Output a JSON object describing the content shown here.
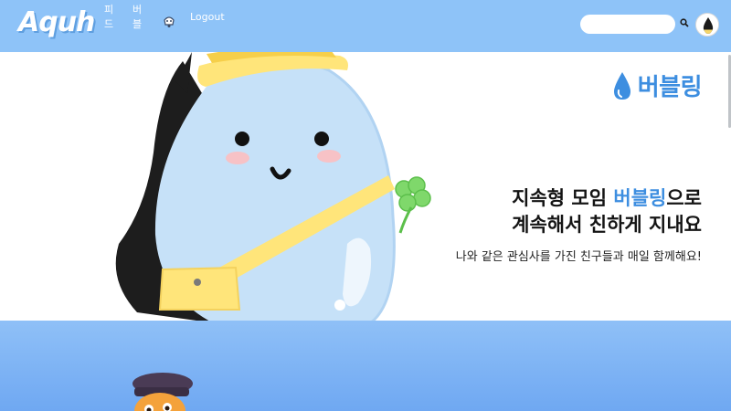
{
  "header": {
    "logo": "Aquh",
    "nav": {
      "feed": "피드",
      "bubble": "버블",
      "logout": "Logout"
    },
    "search": {
      "placeholder": ""
    }
  },
  "hero": {
    "brand": "버블링",
    "headline_part1": "지속형 모임 ",
    "headline_accent": "버블링",
    "headline_part2": "으로",
    "headline_line2": "계속해서 친하게 지내요",
    "subtitle": "나와 같은 관심사를 가진 친구들과 매일 함께해요!"
  },
  "colors": {
    "header_bg": "#8ec3f8",
    "accent": "#3d8ee0",
    "section2_bg": "#7fb5f5"
  },
  "icons": {
    "nav_icon": "bell-icon",
    "search": "search-icon",
    "avatar": "water-drop-avatar"
  }
}
